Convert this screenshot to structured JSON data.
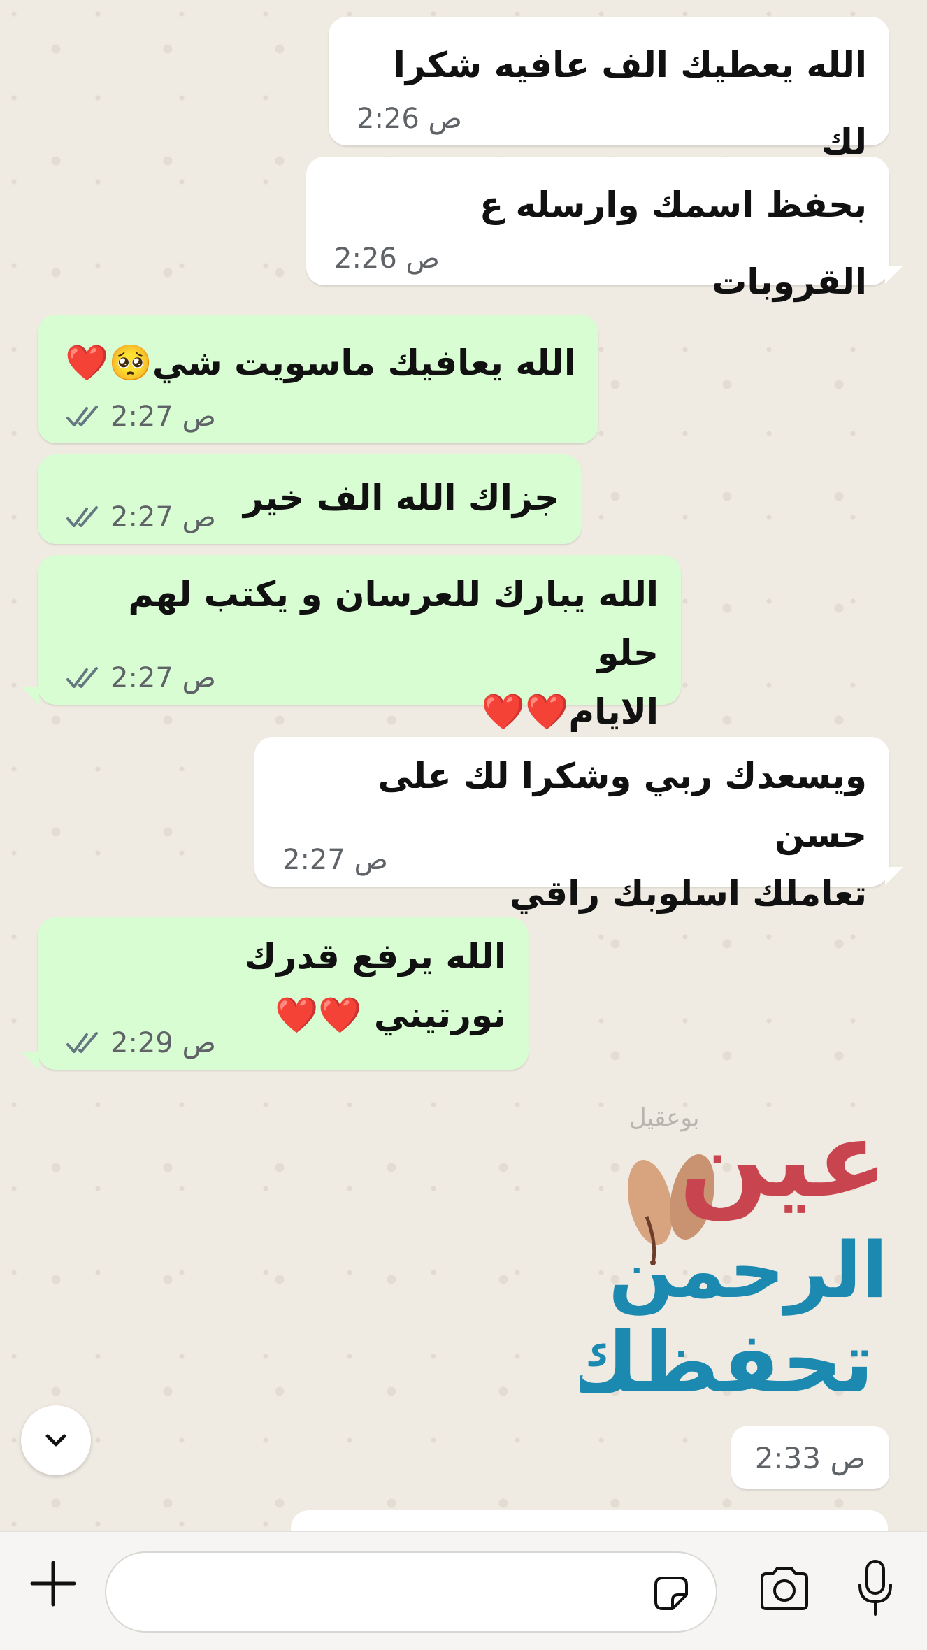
{
  "messages": [
    {
      "dir": "in",
      "text": "الله يعطيك الف عافيه شكرا لك",
      "time": "2:26 ص"
    },
    {
      "dir": "in",
      "text": "بحفظ اسمك وارسله ع القروبات",
      "time": "2:26 ص"
    },
    {
      "dir": "out",
      "text": "الله يعافيك ماسويت شي🥺❤️",
      "time": "2:27 ص",
      "read": true
    },
    {
      "dir": "out",
      "text": "جزاك الله الف خير",
      "time": "2:27 ص",
      "read": true
    },
    {
      "dir": "out",
      "text_line1": "الله يبارك للعرسان و يكتب لهم حلو",
      "text_line2": "الايام❤️❤️",
      "time": "2:27 ص",
      "read": true
    },
    {
      "dir": "in",
      "text_line1": "ويسعدك ربي وشكرا لك على حسن",
      "text_line2": "تعاملك اسلوبك راقي",
      "time": "2:27 ص"
    },
    {
      "dir": "out",
      "text_line1": "الله يرفع قدرك",
      "text_line2": "نورتيني ❤️❤️",
      "time": "2:29 ص",
      "read": true
    }
  ],
  "sticker": {
    "author": "بوعقيل",
    "line1": "عين",
    "line2": "الرحمن",
    "line3": "تحفظك",
    "time": "2:33 ص"
  },
  "colors": {
    "incoming": "#ffffff",
    "outgoing": "#d9fdd3",
    "read_ticks": "#667781",
    "sticker_red": "#c8444f",
    "sticker_blue": "#1c8ab0"
  },
  "icons": {
    "scroll": "chevron-down-icon",
    "attach": "plus-icon",
    "sticker": "sticker-icon",
    "camera": "camera-icon",
    "mic": "microphone-icon"
  },
  "composer": {
    "value": "",
    "placeholder": ""
  }
}
